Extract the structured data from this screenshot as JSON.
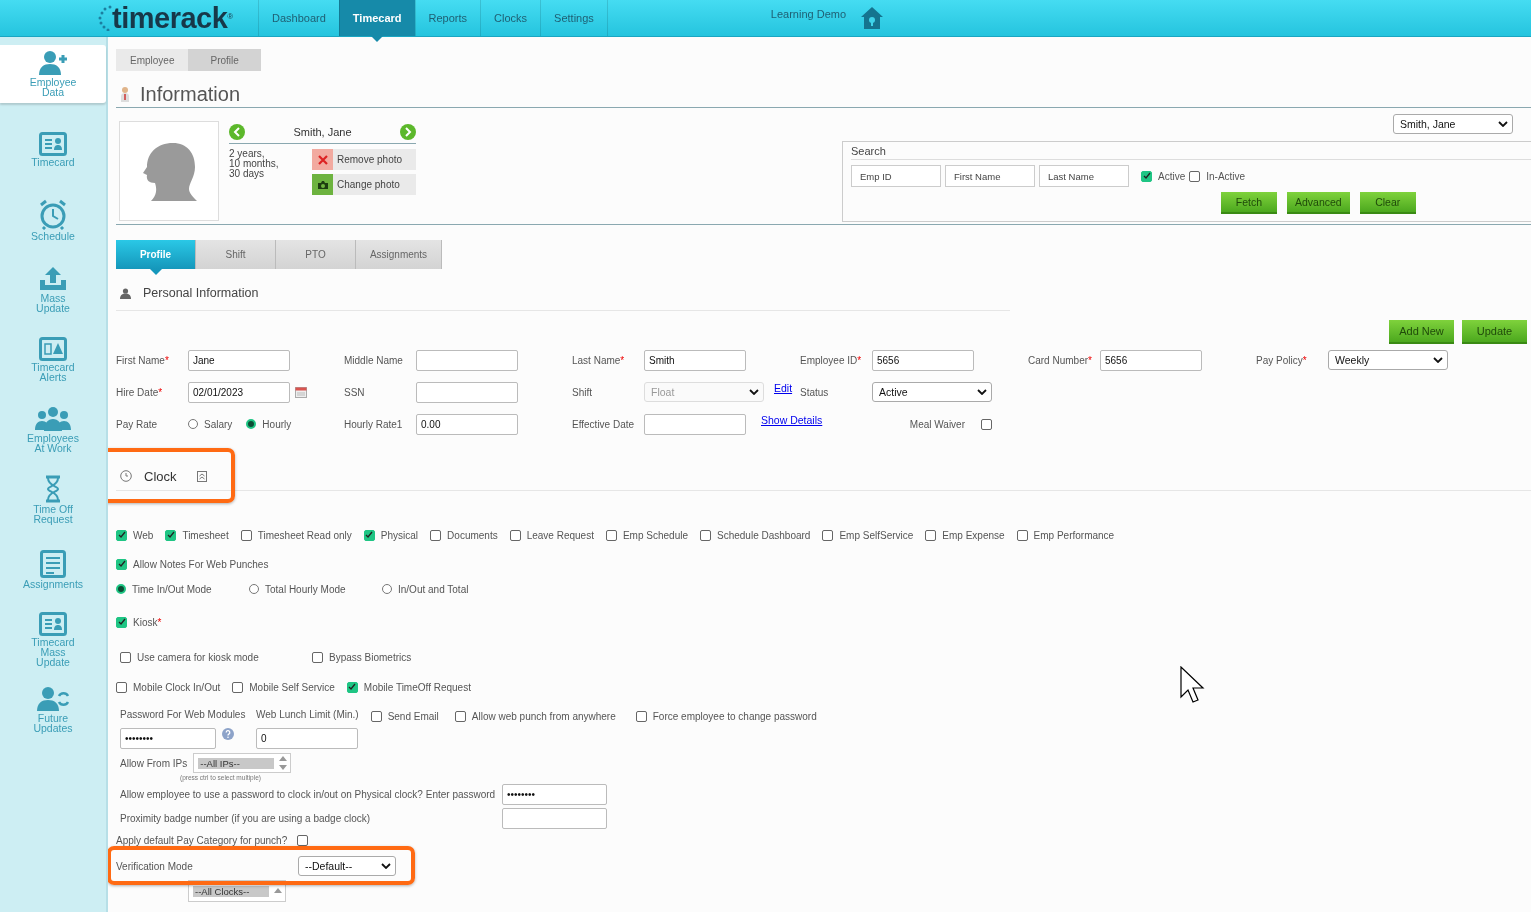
{
  "header": {
    "logo": "timerack",
    "logo_mark": "®",
    "account": "Learning Demo",
    "nav": [
      {
        "label": "Dashboard",
        "selected": false
      },
      {
        "label": "Timecard",
        "selected": true
      },
      {
        "label": "Reports",
        "selected": false
      },
      {
        "label": "Clocks",
        "selected": false
      },
      {
        "label": "Settings",
        "selected": false
      }
    ]
  },
  "sidebar": {
    "items": [
      {
        "label": "Employee Data",
        "selected": true
      },
      {
        "label": "Timecard",
        "selected": false
      },
      {
        "label": "Schedule",
        "selected": false
      },
      {
        "label": "Mass Update",
        "selected": false
      },
      {
        "label": "Timecard Alerts",
        "selected": false
      },
      {
        "label": "Employees At Work",
        "selected": false
      },
      {
        "label": "Time Off Request",
        "selected": false
      },
      {
        "label": "Assignments",
        "selected": false
      },
      {
        "label": "Timecard Mass Update",
        "selected": false
      },
      {
        "label": "Future Updates",
        "selected": false
      }
    ]
  },
  "breadcrumb": [
    "Employee",
    "Profile"
  ],
  "page_title": "Information",
  "employee": {
    "name": "Smith, Jane",
    "tenure": [
      "2 years,",
      "10 months,",
      "30 days"
    ],
    "remove_photo": "Remove photo",
    "change_photo": "Change photo"
  },
  "employee_select": "Smith, Jane",
  "search": {
    "title": "Search",
    "fields": [
      {
        "placeholder": "Emp ID"
      },
      {
        "placeholder": "First Name"
      },
      {
        "placeholder": "Last Name"
      }
    ],
    "filters": [
      {
        "label": "Active",
        "checked": true
      },
      {
        "label": "In-Active",
        "checked": false
      }
    ],
    "buttons": [
      "Fetch",
      "Advanced",
      "Clear"
    ]
  },
  "tabs": [
    {
      "label": "Profile",
      "selected": true
    },
    {
      "label": "Shift",
      "selected": false
    },
    {
      "label": "PTO",
      "selected": false
    },
    {
      "label": "Assignments",
      "selected": false
    }
  ],
  "personal": {
    "title": "Personal Information",
    "buttons": [
      "Add New",
      "Update"
    ],
    "rows": [
      [
        {
          "label": "First Name",
          "required_mark": "*",
          "kind": "text",
          "value": "Jane"
        },
        {
          "label": "Middle Name",
          "kind": "text"
        },
        {
          "label": "Last Name",
          "required_mark": "*",
          "kind": "text",
          "value": "Smith"
        },
        {
          "label": "Employee ID",
          "required_mark": "*",
          "kind": "text",
          "value": "5656"
        },
        {
          "label": "Card Number",
          "required_mark": "*",
          "kind": "text",
          "value": "5656"
        },
        {
          "label": "Pay Policy",
          "required_mark": "*",
          "kind": "select",
          "value": "Weekly",
          "disabled": false
        }
      ],
      [
        {
          "label": "Hire Date",
          "required_mark": "*",
          "kind": "date",
          "value": "02/01/2023"
        },
        {
          "label": "SSN",
          "kind": "text"
        },
        {
          "label": "Shift",
          "kind": "select",
          "value": "Float",
          "disabled": true,
          "link": "Edit"
        },
        {
          "label": "Status",
          "kind": "select",
          "value": "Active",
          "disabled": false
        }
      ],
      [
        {
          "label": "Pay Rate",
          "kind": "radio",
          "options": [
            {
              "label": "Salary",
              "selected": false
            },
            {
              "label": "Hourly",
              "selected": true
            }
          ]
        },
        {
          "label": "Hourly Rate1",
          "kind": "text",
          "value": "0.00"
        },
        {
          "label": "Effective Date",
          "kind": "date",
          "link": "Show Details"
        },
        {
          "label": "Meal Waiver",
          "kind": "checkbox",
          "checked": false
        }
      ]
    ]
  },
  "clock": {
    "title": "Clock",
    "modules": [
      {
        "label": "Web",
        "checked": true
      },
      {
        "label": "Timesheet",
        "checked": true
      },
      {
        "label": "Timesheet Read only",
        "checked": false
      },
      {
        "label": "Physical",
        "checked": true
      },
      {
        "label": "Documents",
        "checked": false
      },
      {
        "label": "Leave Request",
        "checked": false
      },
      {
        "label": "Emp Schedule",
        "checked": false
      },
      {
        "label": "Schedule Dashboard",
        "checked": false
      },
      {
        "label": "Emp SelfService",
        "checked": false
      },
      {
        "label": "Emp Expense",
        "checked": false
      },
      {
        "label": "Emp Performance",
        "checked": false
      }
    ],
    "allow_notes": {
      "label": "Allow Notes For Web Punches",
      "checked": true
    },
    "modes": [
      {
        "label": "Time In/Out Mode",
        "selected": true
      },
      {
        "label": "Total Hourly Mode",
        "selected": false
      },
      {
        "label": "In/Out and Total",
        "selected": false
      }
    ],
    "kiosk": {
      "label": "Kiosk",
      "required_mark": "*",
      "checked": true
    },
    "kiosk_options": [
      {
        "label": "Use camera for kiosk mode",
        "checked": false
      },
      {
        "label": "Bypass Biometrics",
        "checked": false
      }
    ],
    "mobile": [
      {
        "label": "Mobile Clock In/Out",
        "checked": false
      },
      {
        "label": "Mobile Self Service",
        "checked": false
      },
      {
        "label": "Mobile TimeOff Request",
        "checked": true
      }
    ],
    "web_password": {
      "label": "Password For Web Modules",
      "value": "••••••••"
    },
    "lunch_limit": {
      "label": "Web Lunch Limit (Min.)",
      "value": "0"
    },
    "web_options": [
      {
        "label": "Send Email",
        "checked": false
      },
      {
        "label": "Allow web punch from anywhere",
        "checked": false
      },
      {
        "label": "Force employee to change password",
        "checked": false
      }
    ],
    "allow_ips": {
      "label": "Allow From IPs",
      "value": "--All IPs--",
      "hint": "(press ctrl to select multiple)"
    },
    "physical_password": {
      "label": "Allow employee to use a password to clock in/out on Physical clock? Enter password",
      "value": "••••••••"
    },
    "badge": {
      "label": "Proximity badge number (if you are using a badge clock)"
    },
    "pay_category": {
      "label": "Apply default Pay Category for punch?",
      "checked": false
    },
    "verification": {
      "label": "Verification Mode",
      "value": "--Default--"
    },
    "clocks": {
      "value": "--All Clocks--"
    }
  }
}
